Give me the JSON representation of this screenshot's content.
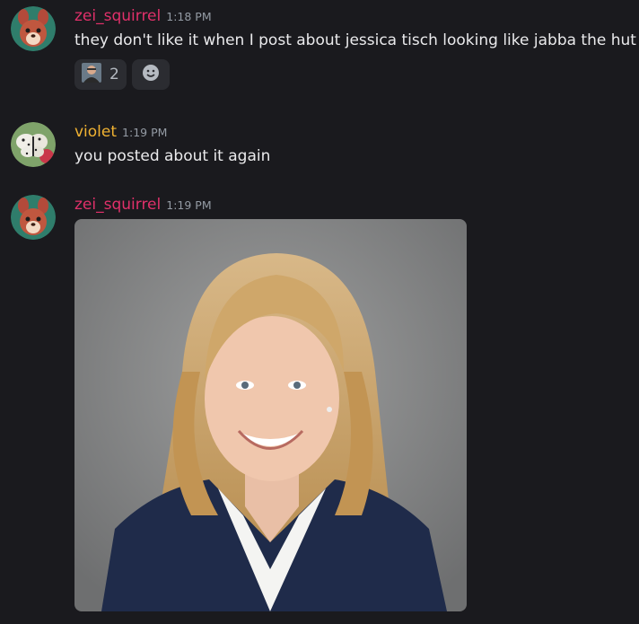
{
  "colors": {
    "background": "#1a1a1e",
    "zei_name": "#e0306a",
    "violet_name": "#f0b232",
    "message_text": "#eaeaec",
    "timestamp": "#949ba4",
    "reaction_bg": "#2b2c31"
  },
  "messages": [
    {
      "username": "zei_squirrel",
      "timestamp": "1:18 PM",
      "text": "they don't like it when I post about jessica tisch looking like jabba the hut",
      "avatar": "squirrel-avatar",
      "reactions": [
        {
          "icon": "person-photo-emoji",
          "count": "2"
        }
      ],
      "add_reaction_icon": "smiley-icon"
    },
    {
      "username": "violet",
      "timestamp": "1:19 PM",
      "text": "you posted about it again",
      "avatar": "butterfly-avatar"
    },
    {
      "username": "zei_squirrel",
      "timestamp": "1:19 PM",
      "avatar": "squirrel-avatar",
      "attachment": "portrait-photo"
    }
  ]
}
